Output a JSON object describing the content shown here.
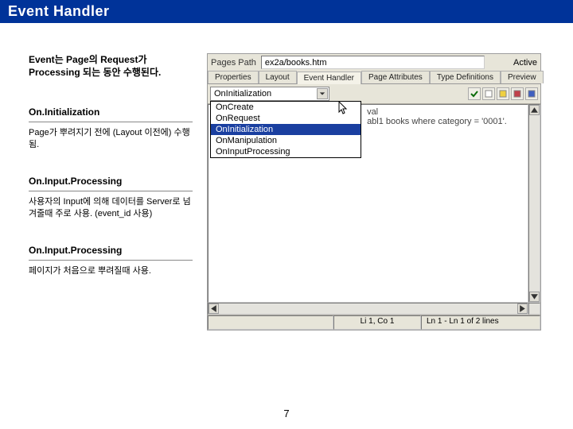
{
  "title": "Event Handler",
  "intro": "Event는 Page의 Request가 Processing 되는 동안 수행된다.",
  "sections": [
    {
      "heading": "On.Initialization",
      "body": "Page가 뿌려지기 전에 (Layout 이전에) 수행됨."
    },
    {
      "heading": "On.Input.Processing",
      "body": "사용자의 Input에 의해 데이터를 Server로 넘겨줄때 주로 사용. (event_id 사용)"
    },
    {
      "heading": "On.Input.Processing",
      "body": "페이지가 처음으로 뿌려질때 사용."
    }
  ],
  "app": {
    "path_label": "Pages Path",
    "path_value": "ex2a/books.htm",
    "active_label": "Active",
    "tabs": [
      "Properties",
      "Layout",
      "Event Handler",
      "Page Attributes",
      "Type Definitions",
      "Preview"
    ],
    "active_tab": 2,
    "combo_value": "OnInitialization",
    "combo_items": [
      "OnCreate",
      "OnRequest",
      "OnInitialization",
      "OnManipulation",
      "OnInputProcessing"
    ],
    "combo_selected": 2,
    "editor_snippet_a": "val",
    "editor_snippet_b": "abl1 books where category = '0001'.",
    "colmarker": "|",
    "status_mid": "Li 1, Co 1",
    "status_right": "Ln 1 - Ln 1 of 2 lines"
  },
  "page_number": "7"
}
